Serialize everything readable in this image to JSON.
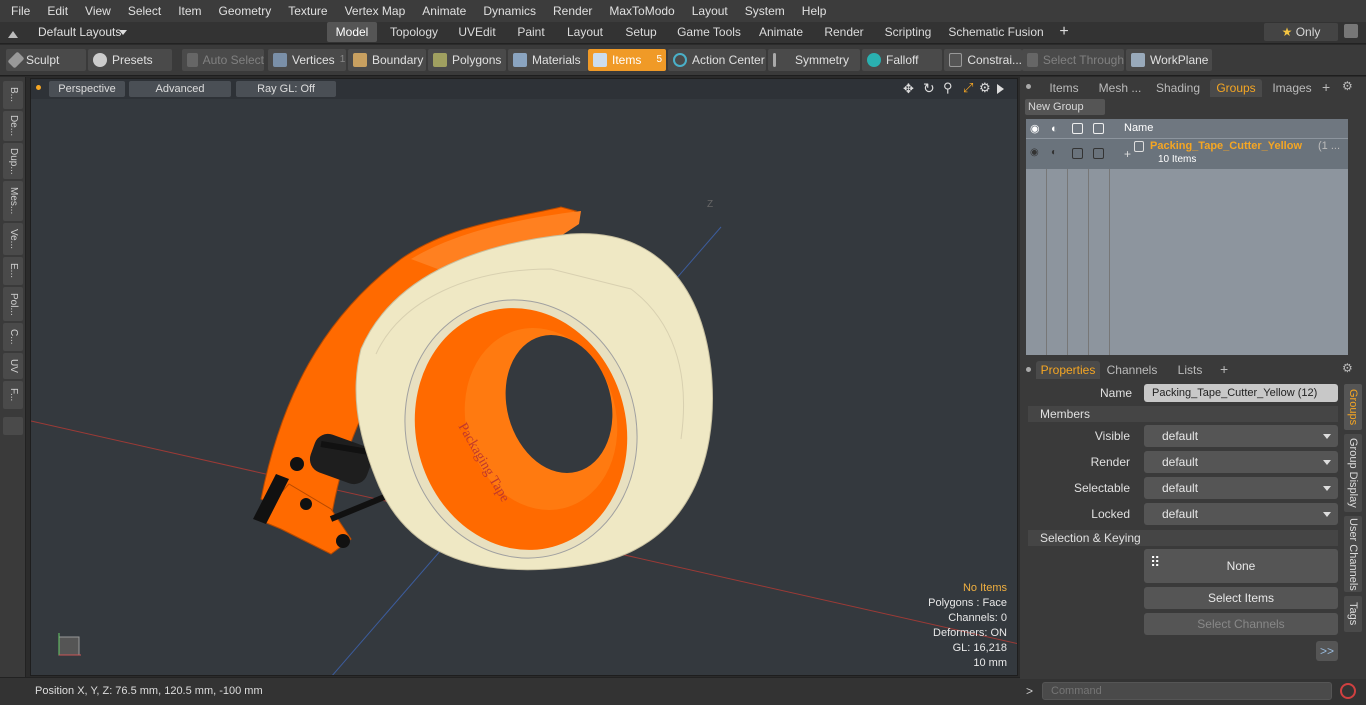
{
  "menu": [
    "File",
    "Edit",
    "View",
    "Select",
    "Item",
    "Geometry",
    "Texture",
    "Vertex Map",
    "Animate",
    "Dynamics",
    "Render",
    "MaxToModo",
    "Layout",
    "System",
    "Help"
  ],
  "layouts": {
    "label": "Default Layouts"
  },
  "mode_tabs": [
    "Model",
    "Topology",
    "UVEdit",
    "Paint",
    "Layout",
    "Setup",
    "Game Tools",
    "Animate",
    "Render",
    "Scripting",
    "Schematic Fusion"
  ],
  "only_label": "Only",
  "toolbar": {
    "sculpt": "Sculpt",
    "presets": "Presets",
    "auto_select": "Auto Select",
    "vertices": "Vertices",
    "vertices_count": "1",
    "boundary": "Boundary",
    "polygons": "Polygons",
    "materials": "Materials",
    "items": "Items",
    "items_count": "5",
    "action_center": "Action Center",
    "symmetry": "Symmetry",
    "falloff": "Falloff",
    "constraints": "Constrai...",
    "select_through": "Select Through",
    "workplane": "WorkPlane"
  },
  "left_tabs": [
    "B...",
    "De...",
    "Dup...",
    "Mes...",
    "Ve...",
    "E...",
    "Pol...",
    "C...",
    "UV",
    "F..."
  ],
  "viewport": {
    "view": "Perspective",
    "shading": "Advanced",
    "raygl": "Ray GL: Off",
    "axis_z": "Z",
    "label_text": "Packaging Tape"
  },
  "stats": {
    "no_items": "No Items",
    "polygons": "Polygons : Face",
    "channels": "Channels: 0",
    "deformers": "Deformers: ON",
    "gl": "GL: 16,218",
    "scale": "10 mm"
  },
  "status": {
    "position": "Position X, Y, Z:   76.5 mm, 120.5 mm, -100 mm"
  },
  "panel_tabs": [
    "Items",
    "Mesh ...",
    "Shading",
    "Groups",
    "Images"
  ],
  "new_group": "New Group",
  "list_header": "Name",
  "group": {
    "name": "Packing_Tape_Cutter_Yellow",
    "suffix": "(1 ...",
    "count": "10 Items"
  },
  "prop_tabs": [
    "Properties",
    "Channels",
    "Lists"
  ],
  "properties": {
    "name_label": "Name",
    "name_value": "Packing_Tape_Cutter_Yellow (12)",
    "members": "Members",
    "rows": [
      {
        "label": "Visible",
        "value": "default"
      },
      {
        "label": "Render",
        "value": "default"
      },
      {
        "label": "Selectable",
        "value": "default"
      },
      {
        "label": "Locked",
        "value": "default"
      }
    ],
    "selection_keying": "Selection & Keying",
    "none": "None",
    "select_items": "Select Items",
    "select_channels": "Select Channels",
    "more": ">>"
  },
  "right_tabs": [
    "Groups",
    "Group Display",
    "User Channels",
    "Tags"
  ],
  "command": {
    "placeholder": "Command"
  },
  "colors": {
    "accent": "#f5a623",
    "tape": "#efe8c4",
    "dispenser": "#ff6a00"
  }
}
